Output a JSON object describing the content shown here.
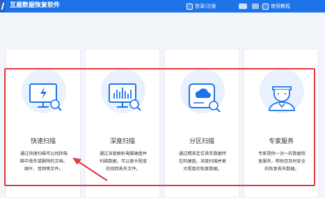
{
  "titlebar": {
    "app_title": "互盾数据恢复软件",
    "login_label": "登录/注册",
    "help_label": "使用教程"
  },
  "cards": [
    {
      "label": "快速扫描",
      "desc": "通过快速扫描可以找回电\n脑中丢失或删除的文档、\n图片、音频等文件。",
      "icon": "monitor-lightning-icon"
    },
    {
      "label": "深度扫描",
      "desc": "通过深度解析电脑硬盘并\n扫描数据，可以更大程度\n的找回丢失文件。",
      "icon": "monitor-chart-icon"
    },
    {
      "label": "分区扫描",
      "desc": "通过精准定位丢失数据所\n在的硬盘，深度扫描并更\n大程度的恢复数据。",
      "icon": "disk-cloud-icon"
    },
    {
      "label": "专家服务",
      "desc": "专家提供一对一的数据恢\n复服务，帮助您及时安全\n的恢复丢失数据。",
      "icon": "expert-icon"
    }
  ],
  "colors": {
    "accent": "#1d73e8",
    "highlight": "#e0393e"
  }
}
